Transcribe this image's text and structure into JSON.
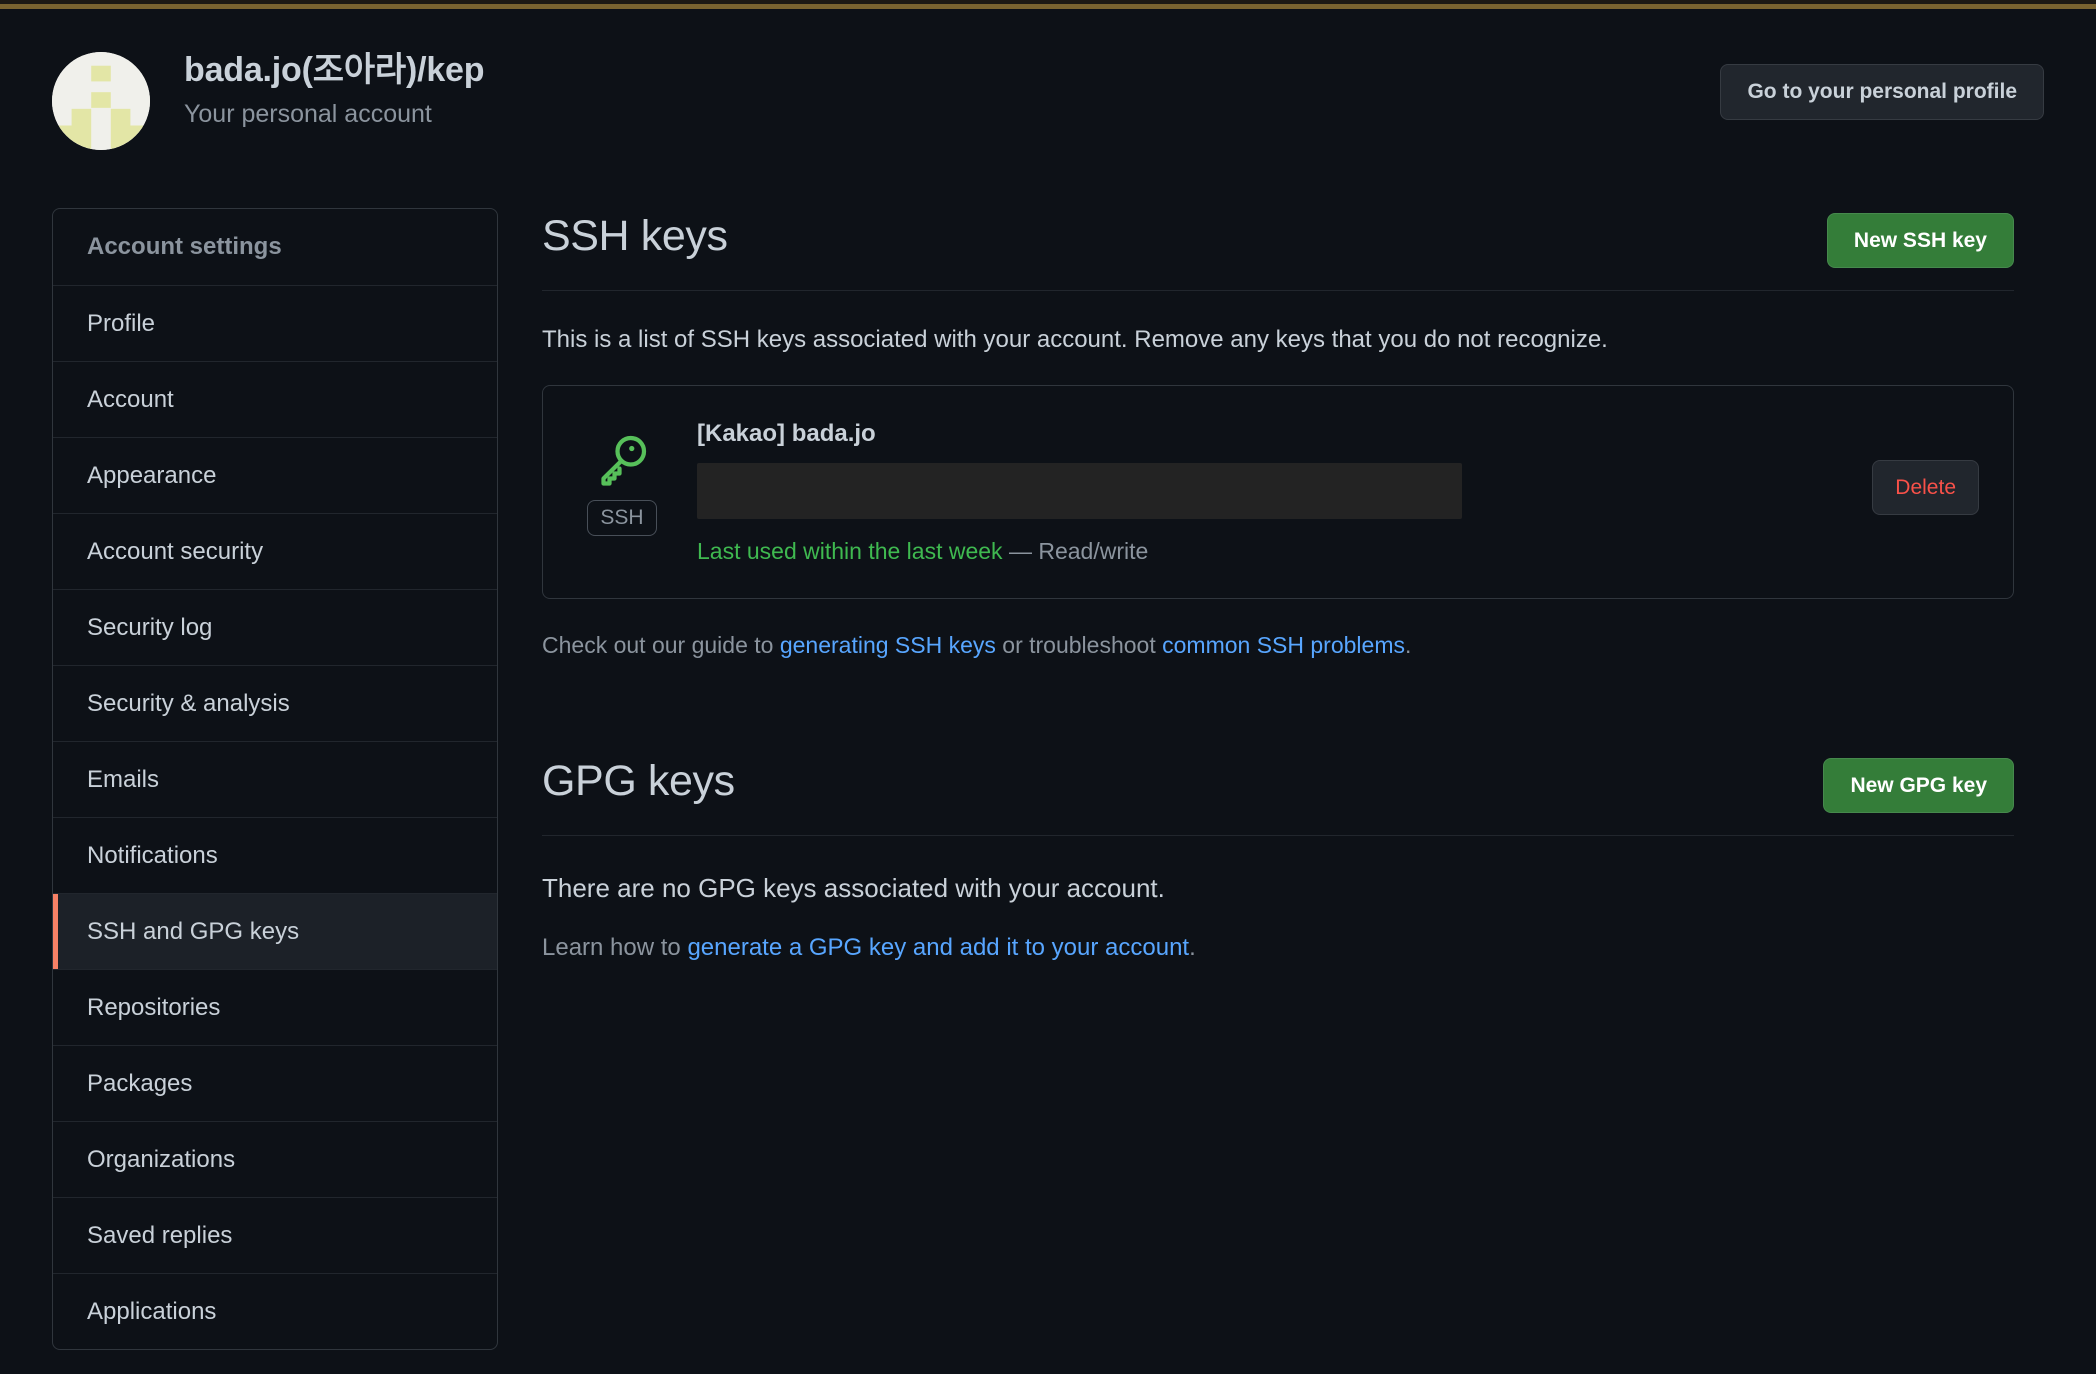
{
  "theme": {
    "background": "#0d1117",
    "border": "#30363d",
    "text_primary": "#c9d1d9",
    "text_muted": "#8b949e",
    "link": "#58a6ff",
    "accent_green": "#347d39",
    "danger": "#f85149",
    "selected_indicator": "#f78166",
    "key_icon_green": "#3fb950",
    "top_strip": "#7a6430"
  },
  "header": {
    "avatar_icon": "identicon-avatar",
    "title": "bada.jo(조아라)/kep",
    "subtitle": "Your personal account",
    "profile_button": "Go to your personal profile"
  },
  "sidebar": {
    "items": [
      {
        "label": "Account settings",
        "selected": false,
        "heading": true
      },
      {
        "label": "Profile",
        "selected": false
      },
      {
        "label": "Account",
        "selected": false
      },
      {
        "label": "Appearance",
        "selected": false
      },
      {
        "label": "Account security",
        "selected": false
      },
      {
        "label": "Security log",
        "selected": false
      },
      {
        "label": "Security & analysis",
        "selected": false
      },
      {
        "label": "Emails",
        "selected": false
      },
      {
        "label": "Notifications",
        "selected": false
      },
      {
        "label": "SSH and GPG keys",
        "selected": true
      },
      {
        "label": "Repositories",
        "selected": false
      },
      {
        "label": "Packages",
        "selected": false
      },
      {
        "label": "Organizations",
        "selected": false
      },
      {
        "label": "Saved replies",
        "selected": false
      },
      {
        "label": "Applications",
        "selected": false
      }
    ]
  },
  "ssh_section": {
    "title": "SSH keys",
    "new_button": "New SSH key",
    "description": "This is a list of SSH keys associated with your account. Remove any keys that you do not recognize.",
    "key": {
      "icon": "key-icon",
      "badge": "SSH",
      "title": "[Kakao] bada.jo",
      "fingerprint": "",
      "fingerprint_redacted": true,
      "last_used": "Last used within the last week",
      "separator": "—",
      "access": "Read/write",
      "delete_button": "Delete"
    },
    "helper": {
      "prefix": "Check out our guide to ",
      "link1": "generating SSH keys",
      "middle": " or troubleshoot ",
      "link2": "common SSH problems",
      "suffix": "."
    }
  },
  "gpg_section": {
    "title": "GPG keys",
    "new_button": "New GPG key",
    "empty_message": "There are no GPG keys associated with your account.",
    "learn_prefix": "Learn how to ",
    "learn_link": "generate a GPG key and add it to your account",
    "learn_suffix": "."
  }
}
